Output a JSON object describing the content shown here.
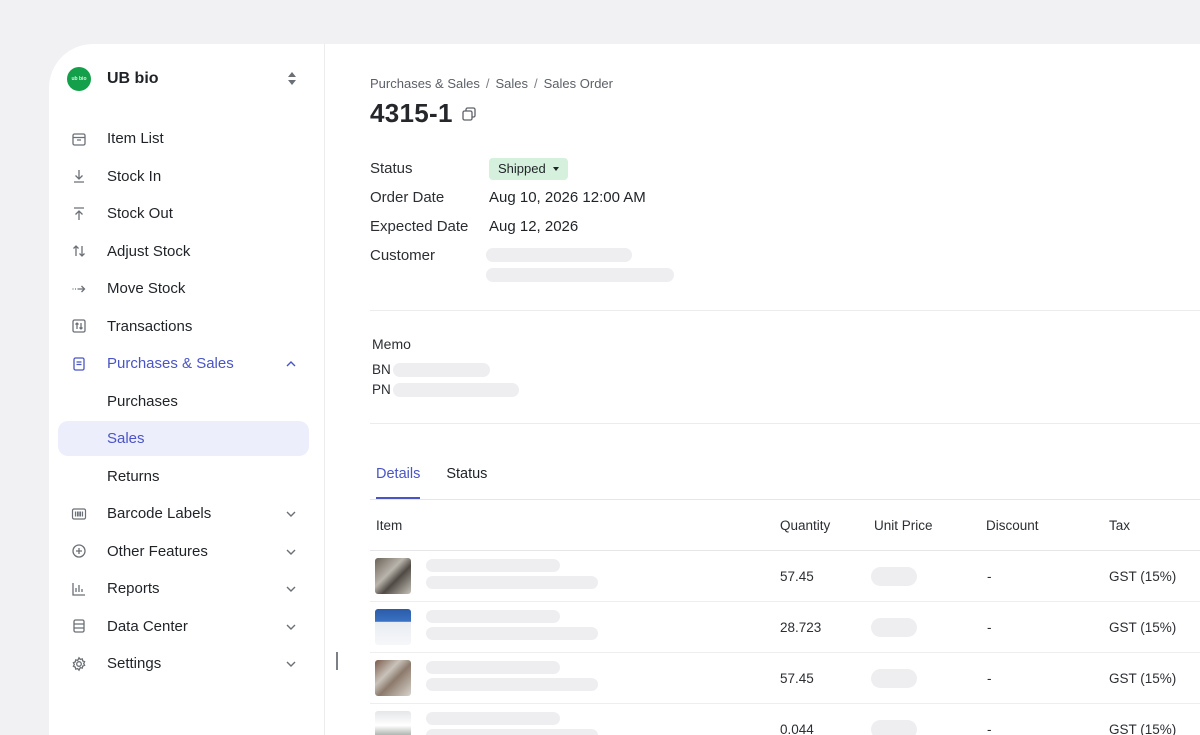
{
  "workspace": {
    "name": "UB bio",
    "logo_text": "ub bio"
  },
  "sidebar": {
    "items": [
      {
        "label": "Item List"
      },
      {
        "label": "Stock In"
      },
      {
        "label": "Stock Out"
      },
      {
        "label": "Adjust Stock"
      },
      {
        "label": "Move Stock"
      },
      {
        "label": "Transactions"
      },
      {
        "label": "Purchases & Sales"
      },
      {
        "label": "Purchases"
      },
      {
        "label": "Sales"
      },
      {
        "label": "Returns"
      },
      {
        "label": "Barcode Labels"
      },
      {
        "label": "Other Features"
      },
      {
        "label": "Reports"
      },
      {
        "label": "Data Center"
      },
      {
        "label": "Settings"
      }
    ]
  },
  "breadcrumb": {
    "items": [
      "Purchases & Sales",
      "Sales",
      "Sales Order"
    ],
    "separator": "/"
  },
  "order": {
    "title": "4315-1",
    "status_label": "Status",
    "status_value": "Shipped",
    "order_date_label": "Order Date",
    "order_date_value": "Aug 10, 2026 12:00 AM",
    "expected_date_label": "Expected Date",
    "expected_date_value": "Aug 12, 2026",
    "customer_label": "Customer"
  },
  "memo": {
    "label": "Memo",
    "bn_label": "BN",
    "pn_label": "PN"
  },
  "tabs": [
    {
      "label": "Details"
    },
    {
      "label": "Status"
    }
  ],
  "table": {
    "headers": {
      "item": "Item",
      "quantity": "Quantity",
      "unit_price": "Unit Price",
      "discount": "Discount",
      "tax": "Tax"
    },
    "rows": [
      {
        "quantity": "57.45",
        "discount": "-",
        "tax": "GST (15%)"
      },
      {
        "quantity": "28.723",
        "discount": "-",
        "tax": "GST (15%)"
      },
      {
        "quantity": "57.45",
        "discount": "-",
        "tax": "GST (15%)"
      },
      {
        "quantity": "0.044",
        "discount": "-",
        "tax": "GST (15%)"
      }
    ]
  },
  "colors": {
    "accent": "#4a54c6",
    "status_badge_bg": "#d5f0dc",
    "logo_green": "#14a04a"
  }
}
